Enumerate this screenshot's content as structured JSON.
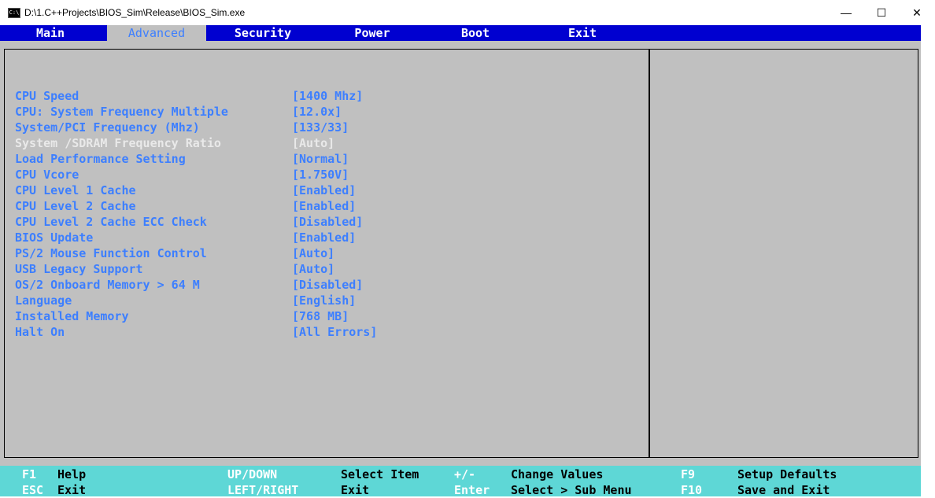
{
  "window": {
    "title": "D:\\1.C++Projects\\BIOS_Sim\\Release\\BIOS_Sim.exe",
    "icon_text": "C:\\",
    "minimize": "—",
    "maximize": "☐",
    "close": "✕"
  },
  "menu": {
    "tabs": [
      {
        "label": "Main"
      },
      {
        "label": "Advanced",
        "active": true
      },
      {
        "label": "Security"
      },
      {
        "label": "Power"
      },
      {
        "label": "Boot"
      },
      {
        "label": "Exit"
      }
    ]
  },
  "settings": [
    {
      "label": "CPU Speed",
      "value": "[1400 Mhz]"
    },
    {
      "label": "CPU: System Frequency Multiple",
      "value": "[12.0x]"
    },
    {
      "label": "System/PCI Frequency (Mhz)",
      "value": "[133/33]"
    },
    {
      "label": "System /SDRAM Frequency Ratio",
      "value": "[Auto]",
      "disabled": true
    },
    {
      "label": "Load Performance Setting",
      "value": "[Normal]"
    },
    {
      "label": "CPU Vcore",
      "value": "[1.750V]"
    },
    {
      "label": "CPU Level 1 Cache",
      "value": "[Enabled]"
    },
    {
      "label": "CPU Level 2 Cache",
      "value": "[Enabled]"
    },
    {
      "label": "CPU Level 2 Cache ECC Check",
      "value": "[Disabled]"
    },
    {
      "label": "BIOS Update",
      "value": "[Enabled]"
    },
    {
      "label": "PS/2 Mouse Function Control",
      "value": "[Auto]"
    },
    {
      "label": "USB Legacy Support",
      "value": "[Auto]"
    },
    {
      "label": "OS/2 Onboard Memory > 64 M",
      "value": "[Disabled]"
    },
    {
      "label": "Language",
      "value": "[English]"
    },
    {
      "label": "Installed Memory",
      "value": "[768 MB]"
    },
    {
      "label": "Halt On",
      "value": "[All Errors]"
    }
  ],
  "footer": {
    "f1_key": "F1",
    "f1_desc": "Help",
    "esc_key": "ESC",
    "esc_desc": "Exit",
    "updown_key": "UP/DOWN",
    "updown_desc": "Select Item",
    "leftright_key": "LEFT/RIGHT",
    "leftright_desc": "Exit",
    "plusminus_key": "+/-",
    "plusminus_desc": "Change Values",
    "enter_key": "Enter",
    "enter_desc": "Select > Sub Menu",
    "f9_key": "F9",
    "f9_desc": "Setup Defaults",
    "f10_key": "F10",
    "f10_desc": "Save and Exit"
  },
  "colors": {
    "menubar": "#0000d0",
    "panel": "#c0c0c0",
    "accent_text": "#3d7fff",
    "footer": "#5ed7d6"
  }
}
